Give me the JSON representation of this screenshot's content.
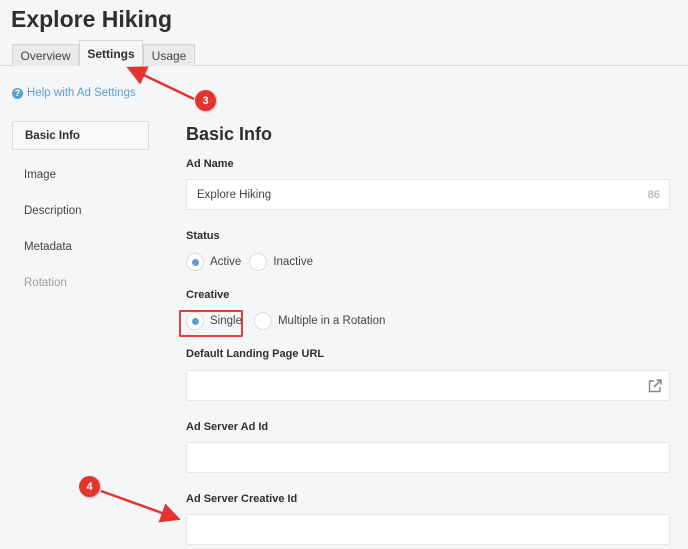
{
  "page": {
    "title": "Explore Hiking"
  },
  "tabs": [
    {
      "label": "Overview",
      "active": false
    },
    {
      "label": "Settings",
      "active": true
    },
    {
      "label": "Usage",
      "active": false
    }
  ],
  "help": {
    "icon": "question-circle-icon",
    "label": "Help with Ad Settings"
  },
  "sidenav": {
    "items": [
      {
        "label": "Basic Info",
        "state": "active"
      },
      {
        "label": "Image",
        "state": "normal"
      },
      {
        "label": "Description",
        "state": "normal"
      },
      {
        "label": "Metadata",
        "state": "normal"
      },
      {
        "label": "Rotation",
        "state": "disabled"
      }
    ]
  },
  "form": {
    "section_title": "Basic Info",
    "ad_name": {
      "label": "Ad Name",
      "value": "Explore Hiking",
      "remaining": "86"
    },
    "status": {
      "label": "Status",
      "options": [
        "Active",
        "Inactive"
      ],
      "selected": "Active"
    },
    "creative": {
      "label": "Creative",
      "options": [
        "Single",
        "Multiple in a Rotation"
      ],
      "selected": "Single"
    },
    "landing_url": {
      "label": "Default Landing Page URL",
      "value": "",
      "icon": "external-link-icon"
    },
    "ad_server_ad_id": {
      "label": "Ad Server Ad Id",
      "value": ""
    },
    "ad_server_creative_id": {
      "label": "Ad Server Creative Id",
      "value": ""
    }
  },
  "annotations": [
    {
      "number": "3",
      "points_to": "Settings tab"
    },
    {
      "number": "4",
      "points_to": "Ad Server Creative Id field"
    }
  ],
  "colors": {
    "accent": "#5aa0cf",
    "annotation": "#e3342f",
    "background": "#f5f6f8"
  }
}
